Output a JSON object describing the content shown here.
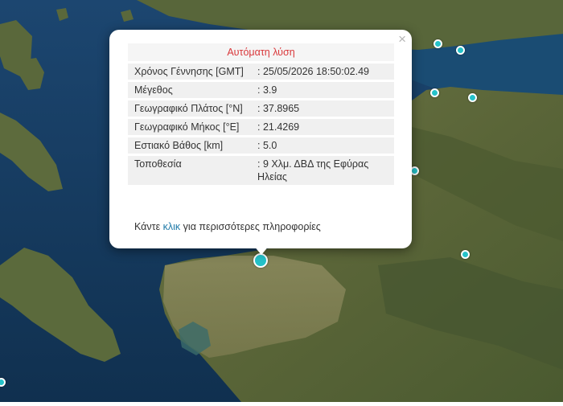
{
  "popup": {
    "close_symbol": "×",
    "title": "Αυτόματη λύση",
    "rows": [
      {
        "label": "Χρόνος Γέννησης [GMT]",
        "value": ": 25/05/2026 18:50:02.49"
      },
      {
        "label": "Μέγεθος",
        "value": ": 3.9"
      },
      {
        "label": "Γεωγραφικό Πλάτος [°N]",
        "value": ": 37.8965"
      },
      {
        "label": "Γεωγραφικό Μήκος [°E]",
        "value": ": 21.4269"
      },
      {
        "label": "Εστιακό Βάθος [km]",
        "value": ": 5.0"
      },
      {
        "label": "Τοποθεσία",
        "value": ": 9 Χλμ. ΔΒΔ της Εφύρας Ηλείας"
      }
    ],
    "footer_before": "Κάντε ",
    "footer_link": "κλικ",
    "footer_after": " για περισσότερες πληροφορίες"
  },
  "colors": {
    "sea": "#163a5e",
    "land": "#5e6b3c",
    "marker": "#25c2c9",
    "title_red": "#d9373a",
    "link": "#1f7aa8"
  }
}
